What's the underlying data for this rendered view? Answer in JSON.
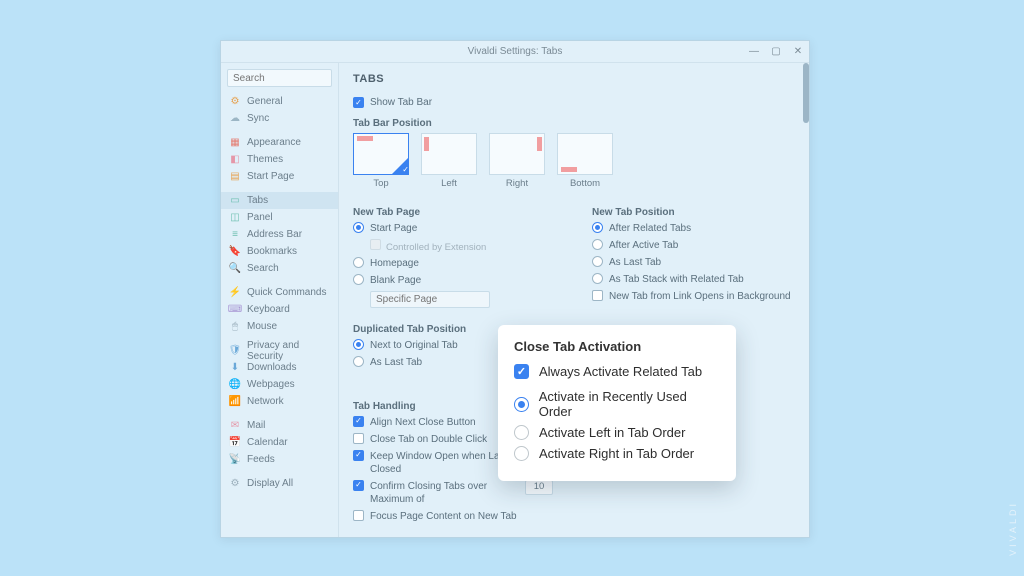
{
  "window": {
    "title": "Vivaldi Settings: Tabs"
  },
  "titlebar": {
    "min": "—",
    "max": "▢",
    "close": "✕"
  },
  "sidebar": {
    "search_placeholder": "Search",
    "items": [
      {
        "label": "General",
        "iconColor": "ic-orange",
        "glyph": "⚙"
      },
      {
        "label": "Sync",
        "iconColor": "ic-cloud",
        "glyph": "☁"
      },
      {
        "label": "Appearance",
        "iconColor": "ic-red",
        "glyph": "▦"
      },
      {
        "label": "Themes",
        "iconColor": "ic-pink",
        "glyph": "◧"
      },
      {
        "label": "Start Page",
        "iconColor": "ic-orange",
        "glyph": "▤"
      },
      {
        "label": "Tabs",
        "iconColor": "ic-teal",
        "glyph": "▭",
        "active": true
      },
      {
        "label": "Panel",
        "iconColor": "ic-teal",
        "glyph": "◫"
      },
      {
        "label": "Address Bar",
        "iconColor": "ic-teal",
        "glyph": "≡"
      },
      {
        "label": "Bookmarks",
        "iconColor": "ic-green",
        "glyph": "🔖"
      },
      {
        "label": "Search",
        "iconColor": "ic-green",
        "glyph": "🔍"
      },
      {
        "label": "Quick Commands",
        "iconColor": "ic-grey",
        "glyph": "⚡"
      },
      {
        "label": "Keyboard",
        "iconColor": "ic-purple",
        "glyph": "⌨"
      },
      {
        "label": "Mouse",
        "iconColor": "ic-grey",
        "glyph": "🖱"
      },
      {
        "label": "Privacy and Security",
        "iconColor": "ic-blue",
        "glyph": "🛡"
      },
      {
        "label": "Downloads",
        "iconColor": "ic-blue",
        "glyph": "⬇"
      },
      {
        "label": "Webpages",
        "iconColor": "ic-blue",
        "glyph": "🌐"
      },
      {
        "label": "Network",
        "iconColor": "ic-blue",
        "glyph": "📶"
      },
      {
        "label": "Mail",
        "iconColor": "ic-pink",
        "glyph": "✉"
      },
      {
        "label": "Calendar",
        "iconColor": "ic-pink",
        "glyph": "📅"
      },
      {
        "label": "Feeds",
        "iconColor": "ic-grey",
        "glyph": "📡"
      },
      {
        "label": "Display All",
        "iconColor": "ic-grey",
        "glyph": "⚙"
      }
    ]
  },
  "main": {
    "heading": "TABS",
    "show_tab_bar": "Show Tab Bar",
    "tab_bar_position": {
      "title": "Tab Bar Position",
      "options": [
        "Top",
        "Left",
        "Right",
        "Bottom"
      ],
      "selected": "Top"
    },
    "new_tab_page": {
      "title": "New Tab Page",
      "options": [
        "Start Page",
        "Homepage",
        "Blank Page",
        "Specific Page"
      ],
      "selected": "Start Page",
      "controlled": "Controlled by Extension",
      "specific_placeholder": "Specific Page"
    },
    "new_tab_position": {
      "title": "New Tab Position",
      "options": [
        "After Related Tabs",
        "After Active Tab",
        "As Last Tab",
        "As Tab Stack with Related Tab"
      ],
      "selected": "After Related Tabs",
      "bg_label": "New Tab from Link Opens in Background"
    },
    "duplicated": {
      "title": "Duplicated Tab Position",
      "options": [
        "Next to Original Tab",
        "As Last Tab"
      ],
      "selected": "Next to Original Tab"
    },
    "tab_handling": {
      "title": "Tab Handling",
      "items": [
        {
          "label": "Align Next Close Button",
          "checked": true
        },
        {
          "label": "Close Tab on Double Click",
          "checked": false
        },
        {
          "label": "Keep Window Open when Last Tab is Closed",
          "checked": true
        },
        {
          "label": "Confirm Closing Tabs over Maximum of",
          "checked": true,
          "num": "10"
        },
        {
          "label": "Focus Page Content on New Tab",
          "checked": false
        }
      ]
    }
  },
  "popover": {
    "title": "Close Tab Activation",
    "check_label": "Always Activate Related Tab",
    "options": [
      "Activate in Recently Used Order",
      "Activate Left in Tab Order",
      "Activate Right in Tab Order"
    ],
    "selected": "Activate in Recently Used Order"
  },
  "watermark": "VIVALDI"
}
